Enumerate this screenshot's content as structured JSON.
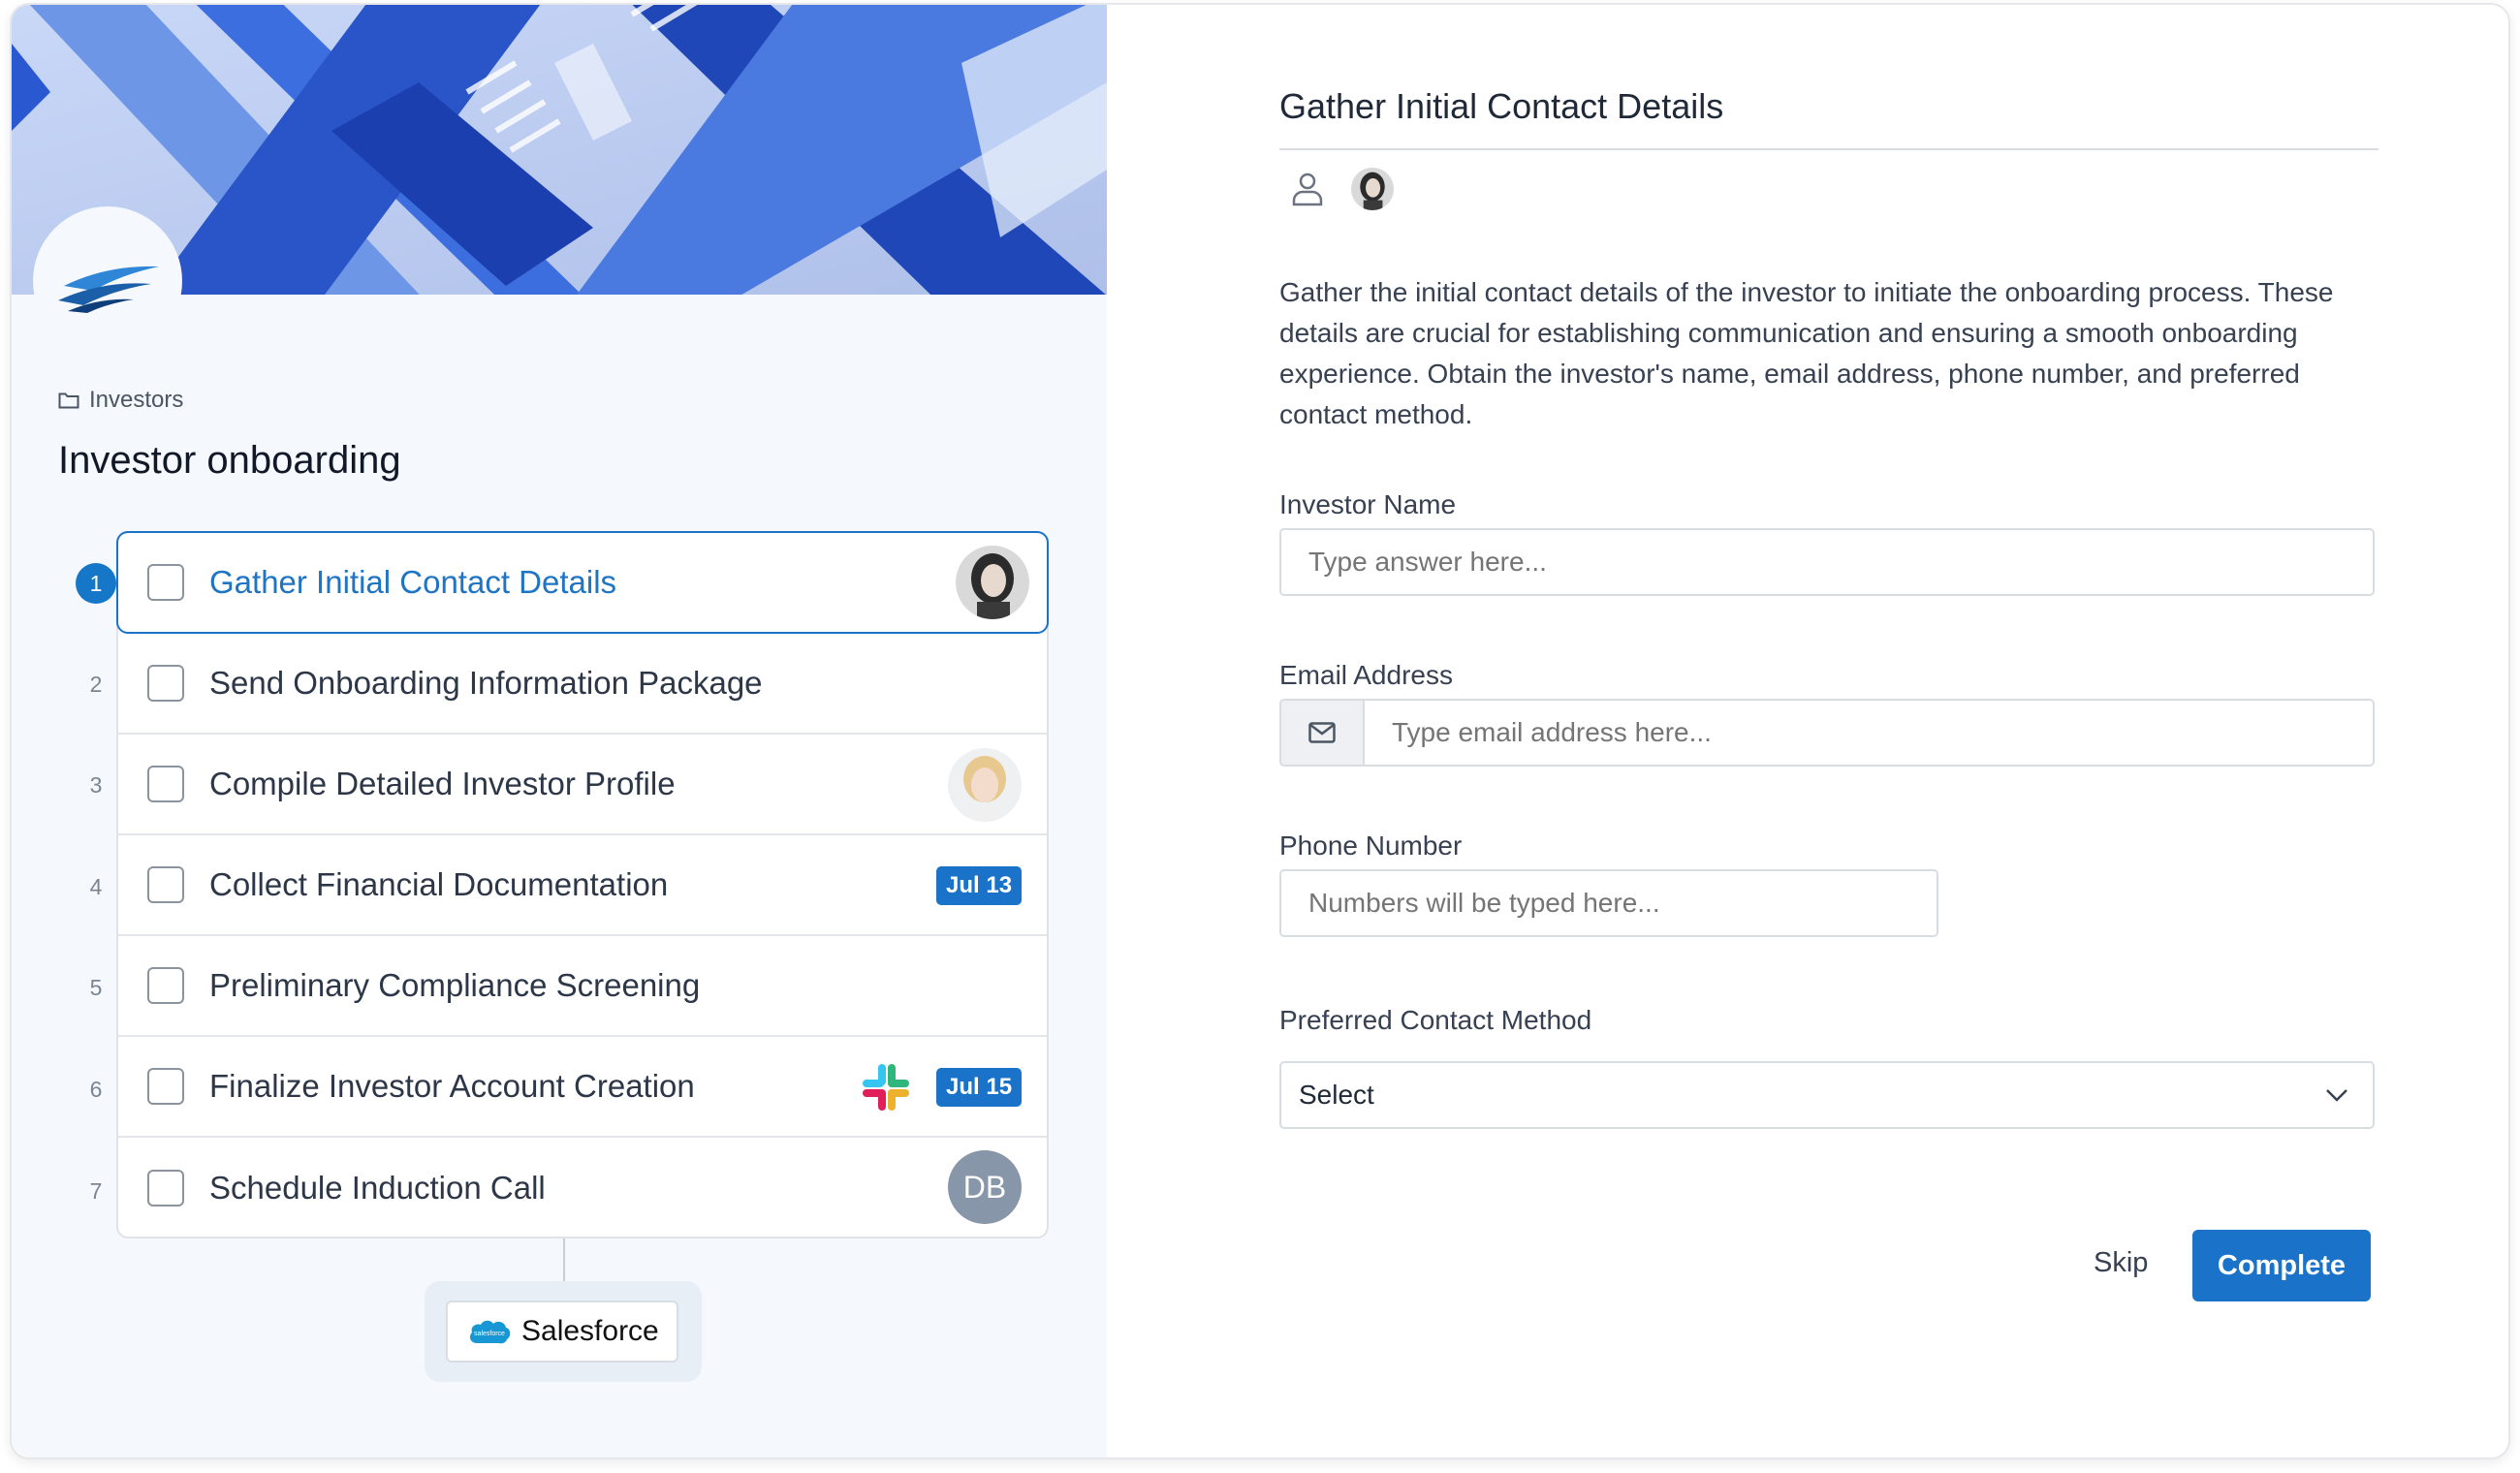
{
  "breadcrumb": {
    "label": "Investors"
  },
  "workflow": {
    "title": "Investor onboarding"
  },
  "steps": [
    {
      "num": "1",
      "label": "Gather Initial Contact Details"
    },
    {
      "num": "2",
      "label": "Send Onboarding Information Package"
    },
    {
      "num": "3",
      "label": "Compile Detailed Investor Profile"
    },
    {
      "num": "4",
      "label": "Collect Financial Documentation",
      "badge": "Jul 13"
    },
    {
      "num": "5",
      "label": "Preliminary Compliance Screening"
    },
    {
      "num": "6",
      "label": "Finalize Investor Account Creation",
      "badge": "Jul 15"
    },
    {
      "num": "7",
      "label": "Schedule Induction Call",
      "initials": "DB"
    }
  ],
  "integration": {
    "label": "Salesforce",
    "logo_text": "salesforce"
  },
  "task": {
    "title": "Gather Initial Contact Details",
    "description": "Gather the initial contact details of the investor to initiate the onboarding process. These details are crucial for establishing communication and ensuring a smooth onboarding experience. Obtain the investor's name, email address, phone number, and preferred contact method."
  },
  "form": {
    "name": {
      "label": "Investor Name",
      "placeholder": "Type answer here..."
    },
    "email": {
      "label": "Email Address",
      "placeholder": "Type email address here..."
    },
    "phone": {
      "label": "Phone Number",
      "placeholder": "Numbers will be typed here..."
    },
    "contact_method": {
      "label": "Preferred Contact Method",
      "value": "Select"
    }
  },
  "actions": {
    "skip": "Skip",
    "complete": "Complete"
  },
  "colors": {
    "accent": "#1a73c9",
    "badge": "#1a73c9"
  }
}
